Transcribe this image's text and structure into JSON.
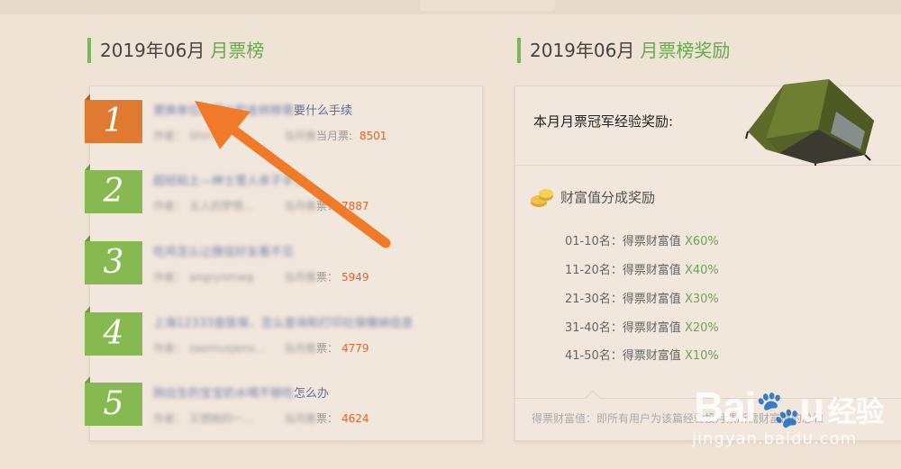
{
  "left_section": {
    "date": "2019年06月",
    "title": "月票榜"
  },
  "right_section": {
    "date": "2019年06月",
    "title": "月票榜奖励"
  },
  "ranking": [
    {
      "rank": "1",
      "title_blurred": "更换单位办理公积金转移需",
      "title_visible": "要什么手续",
      "author_label": "作者：",
      "author_blurred": "Shin...",
      "votes_label": "当月票",
      "votes_label_prefix_blurred": "当月推",
      "votes": "8501"
    },
    {
      "rank": "2",
      "title_blurred": "超轻粘土—绅士雪人亲子手工",
      "title_visible": "",
      "author_label": "作者：",
      "author_blurred": "五人的梦想...",
      "votes_label": "票：",
      "votes_label_prefix_blurred": "当月推",
      "votes": "7887"
    },
    {
      "rank": "3",
      "title_blurred": "吃鸡怎么让微信好友看不见",
      "title_visible": "",
      "author_label": "作者：",
      "author_blurred": "angrynmwg",
      "votes_label": "票：",
      "votes_label_prefix_blurred": "当月推",
      "votes": "5949"
    },
    {
      "rank": "4",
      "title_blurred": "上海12333查医保、怎么查询和打印社保缴纳信息",
      "title_visible": "",
      "author_label": "作者：",
      "author_blurred": "zaomuojenx...",
      "votes_label": "票：",
      "votes_label_prefix_blurred": "当月推",
      "votes": "4779"
    },
    {
      "rank": "5",
      "title_blurred": "刚出生的宝宝奶水喝不够吃",
      "title_visible": "怎么办",
      "author_label": "作者：",
      "author_blurred": "又想她的一...",
      "votes_label": "票：",
      "votes_label_prefix_blurred": "当月推",
      "votes": "4624"
    }
  ],
  "rewards": {
    "champion_label": "本月月票冠军经验奖励:",
    "wealth_title": "财富值分成奖励",
    "tiers": [
      {
        "range": "01-10名：",
        "desc": "得票财富值",
        "pct": "X60%"
      },
      {
        "range": "11-20名：",
        "desc": "得票财富值",
        "pct": "X40%"
      },
      {
        "range": "21-30名：",
        "desc": "得票财富值",
        "pct": "X30%"
      },
      {
        "range": "31-40名：",
        "desc": "得票财富值",
        "pct": "X20%"
      },
      {
        "range": "41-50名：",
        "desc": "得票财富值",
        "pct": "X10%"
      }
    ],
    "footnote": "得票财富值：即所有用户为该篇经验投月票所需财富值的总和"
  },
  "watermark": {
    "logo": "Bai",
    "logo_tail": "u",
    "logo_cn": "经验",
    "url": "jingyan.baidu.com"
  },
  "colors": {
    "accent_green": "#6aa84f",
    "rank1_orange": "#e07a30",
    "votes_orange": "#e0632a",
    "arrow_orange": "#f07a28"
  }
}
